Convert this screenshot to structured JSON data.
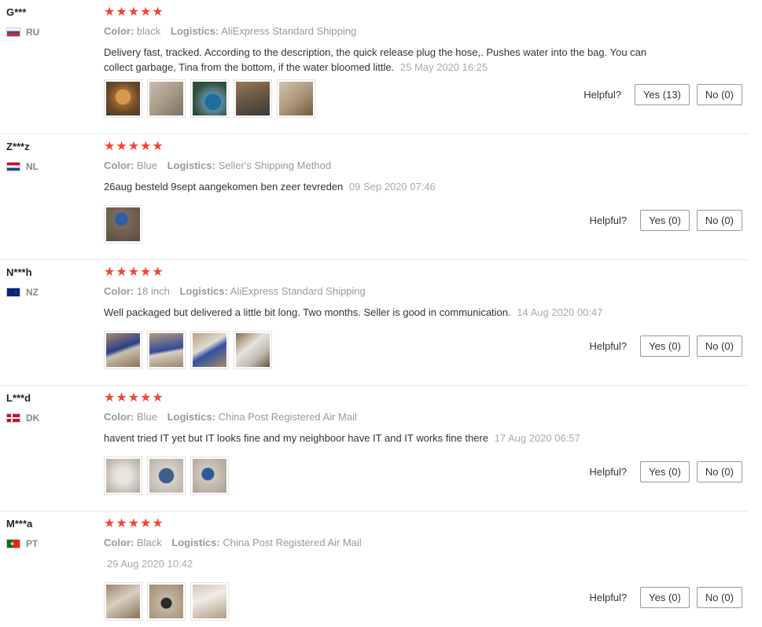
{
  "labels": {
    "color": "Color:",
    "logistics": "Logistics:",
    "helpful": "Helpful?"
  },
  "stars": "★★★★★",
  "reviews": [
    {
      "name": "G***",
      "country": "RU",
      "color": "black",
      "logistics": "AliExpress Standard Shipping",
      "text": "Delivery fast, tracked. According to the description, the quick release plug the hose,. Pushes water into the bag. You can collect garbage, Tina from the bottom, if the water bloomed little.",
      "date": "25 May 2020 16:25",
      "yes": "Yes (13)",
      "no": "No (0)",
      "photos": 5
    },
    {
      "name": "Z***z",
      "country": "NL",
      "color": "Blue",
      "logistics": "Seller's Shipping Method",
      "text": "26aug besteld 9sept aangekomen ben zeer tevreden",
      "date": "09 Sep 2020 07:46",
      "yes": "Yes (0)",
      "no": "No (0)",
      "photos": 1
    },
    {
      "name": "N***h",
      "country": "NZ",
      "color": "18 inch",
      "logistics": "AliExpress Standard Shipping",
      "text": "Well packaged but delivered a little bit long. Two months. Seller is good in communication.",
      "date": "14 Aug 2020 00:47",
      "yes": "Yes (0)",
      "no": "No (0)",
      "photos": 4
    },
    {
      "name": "L***d",
      "country": "DK",
      "color": "Blue",
      "logistics": "China Post Registered Air Mail",
      "text": "havent tried IT yet but IT looks fine and my neighboor have IT and IT works fine there",
      "date": "17 Aug 2020 06:57",
      "yes": "Yes (0)",
      "no": "No (0)",
      "photos": 3
    },
    {
      "name": "M***a",
      "country": "PT",
      "color": "Black",
      "logistics": "China Post Registered Air Mail",
      "text": "",
      "date": "29 Aug 2020 10:42",
      "yes": "Yes (0)",
      "no": "No (0)",
      "photos": 3
    }
  ]
}
